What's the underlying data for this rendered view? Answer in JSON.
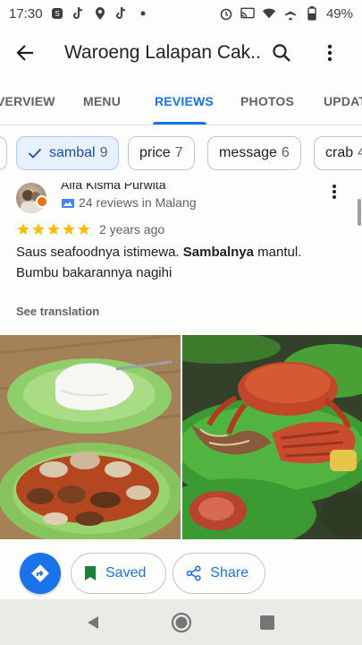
{
  "status_bar": {
    "time": "17:30",
    "battery": "49%",
    "left_icons": [
      "screen-record-icon",
      "tiktok-icon",
      "location-icon",
      "tiktok-icon",
      "dot-icon"
    ],
    "right_icons": [
      "alarm-icon",
      "cast-icon",
      "wifi-icon",
      "airplane-icon",
      "battery-icon"
    ]
  },
  "app_bar": {
    "title": "Waroeng Lalapan Cak...",
    "back_icon": "arrow-back-icon",
    "search_icon": "search-icon",
    "more_icon": "more-vert-icon"
  },
  "tabs": [
    {
      "label": "VERVIEW",
      "active": false
    },
    {
      "label": "MENU",
      "active": false
    },
    {
      "label": "REVIEWS",
      "active": true
    },
    {
      "label": "PHOTOS",
      "active": false
    },
    {
      "label": "UPDAT",
      "active": false
    }
  ],
  "chips": [
    {
      "label": "",
      "count": "",
      "selected": false
    },
    {
      "label": "sambal",
      "count": "9",
      "selected": true
    },
    {
      "label": "price",
      "count": "7",
      "selected": false
    },
    {
      "label": "message",
      "count": "6",
      "selected": false
    },
    {
      "label": "crab",
      "count": "4",
      "selected": false
    }
  ],
  "review": {
    "reviewer_name": "Alfa Kisma Purwita",
    "reviewer_meta": "24 reviews in Malang",
    "rating": 5,
    "max_rating": 5,
    "date": "2 years ago",
    "text_part1": "Saus seafoodnya istimewa. ",
    "text_bold": "Sambalnya",
    "text_part2": " mantul. Bumbu bakarannya nagihi",
    "see_translation": "See translation"
  },
  "photos": [
    {
      "alt_icon": "food-photo-icon"
    },
    {
      "alt_icon": "food-photo-icon"
    }
  ],
  "actions": {
    "directions_icon": "directions-icon",
    "saved_label": "Saved",
    "share_label": "Share"
  },
  "colors": {
    "accent": "#1a73e8",
    "star": "#fbbc04",
    "chip_selected_bg": "#e8f0fe"
  }
}
